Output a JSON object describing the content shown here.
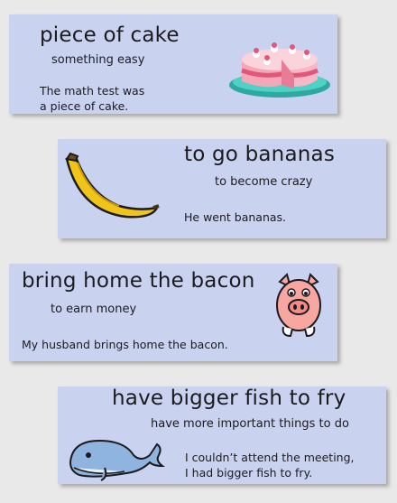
{
  "idioms": [
    {
      "title": "piece of cake",
      "meaning": "something easy",
      "example": [
        "The math test was",
        "a piece of cake."
      ],
      "icon": "cake-icon"
    },
    {
      "title": "to go bananas",
      "meaning": "to become crazy",
      "example": [
        "He went bananas."
      ],
      "icon": "banana-icon"
    },
    {
      "title": "bring home the bacon",
      "meaning": "to earn money",
      "example": [
        "My husband brings home the bacon."
      ],
      "icon": "pig-icon"
    },
    {
      "title": "have bigger fish to fry",
      "meaning": "have more important things to do",
      "example": [
        "I couldn’t attend the meeting,",
        "I had bigger fish to fry."
      ],
      "icon": "whale-icon"
    }
  ],
  "colors": {
    "background": "#e9e9ea",
    "card": "#c9d3ef",
    "text": "#1b1b1f"
  }
}
